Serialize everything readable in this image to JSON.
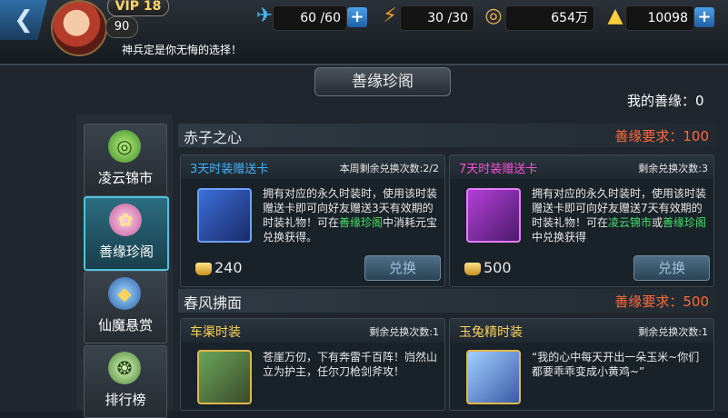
{
  "header": {
    "vip": "VIP 18",
    "level": "90",
    "stamina": "60 /60",
    "energy": "30 /30",
    "coins": "654万",
    "gold": "10098",
    "marquee": "神兵定是你无悔的选择！"
  },
  "panel": {
    "title": "善缘珍阁",
    "my_karma": "我的善缘：0"
  },
  "tabs": [
    {
      "label": "凌云锦市",
      "icon": "jade-coin-icon"
    },
    {
      "label": "善缘珍阁",
      "icon": "lotus-icon"
    },
    {
      "label": "仙魔悬赏",
      "icon": "bounty-crest-icon"
    },
    {
      "label": "排行榜",
      "icon": "ranking-medal-icon"
    }
  ],
  "sections": [
    {
      "title": "赤子之心",
      "requirement": "善缘要求：100",
      "cards": [
        {
          "name": "3天时装赠送卡",
          "remain": "本周剩余兑换次数:2/2",
          "desc_a": "拥有对应的永久时装时，使用该时装赠送卡即可向好友赠送3天有效期的时装礼物！可在",
          "desc_g1": "善缘珍阁",
          "desc_b": "中消耗元宝兑换获得。",
          "desc_g2": "",
          "desc_c": "",
          "price": "240",
          "button": "兑换"
        },
        {
          "name": "7天时装赠送卡",
          "remain": "剩余兑换次数:3",
          "desc_a": "拥有对应的永久时装时，使用该时装赠送卡即可向好友赠送7天有效期的时装礼物！可在",
          "desc_g1": "凌云锦市",
          "desc_b": "或",
          "desc_g2": "善缘珍阁",
          "desc_c": "中兑换获得",
          "price": "500",
          "button": "兑换"
        }
      ]
    },
    {
      "title": "春风拂面",
      "requirement": "善缘要求：500",
      "cards": [
        {
          "name": "车渠时装",
          "remain": "剩余兑换次数:1",
          "desc": "苍崖万仞，下有奔雷千百阵！岿然山立为护主，任尔刀枪剑斧攻！"
        },
        {
          "name": "玉兔精时装",
          "remain": "剩余兑换次数:1",
          "desc": "“我的心中每天开出一朵玉米~你们都要乖乖变成小黄鸡~”"
        }
      ]
    }
  ],
  "colors": {
    "accent": "#4fc3de",
    "requirement": "#ff6a3c",
    "highlight": "#44e16a",
    "card_blue_name": "#3fb4ff",
    "card_pink_name": "#ff4fd8",
    "card_gold_name": "#ffd45a"
  }
}
